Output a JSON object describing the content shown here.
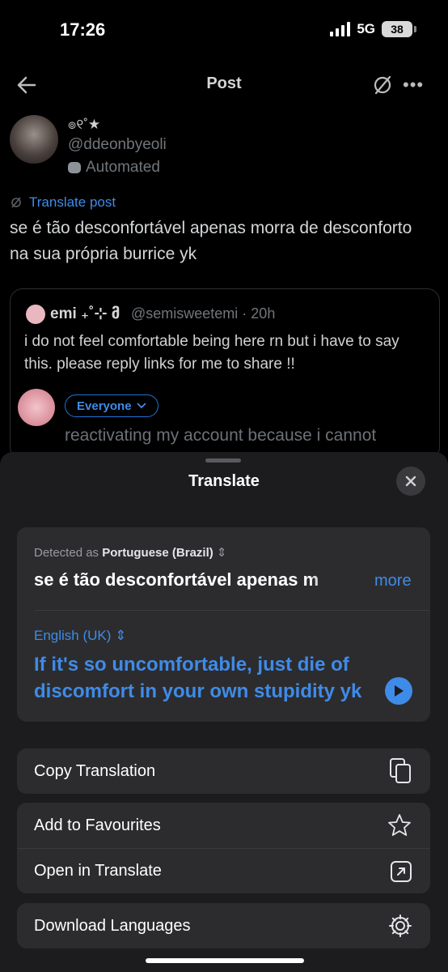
{
  "status": {
    "time": "17:26",
    "network": "5G",
    "battery": "38"
  },
  "nav": {
    "title": "Post"
  },
  "post": {
    "display_name": "๏୧˚★",
    "handle": "@ddeonbyeoli",
    "automated": "Automated",
    "translate_link": "Translate post",
    "text": "se é tão desconfortável apenas morra de desconforto na sua própria burrice yk"
  },
  "quoted": {
    "name": "emi ₊˚⊹ მ",
    "handle_time": "@semisweetemi · 20h",
    "text": "i do not feel comfortable being here rn but i have to say this. please reply links for me to share !!"
  },
  "reply": {
    "audience": "Everyone",
    "text": "reactivating my account because i cannot"
  },
  "sheet": {
    "title": "Translate",
    "detected_prefix": "Detected as",
    "source_language": "Portuguese (Brazil)",
    "source_text": "se é tão desconfortável apenas m",
    "more": "more",
    "target_language": "English (UK)",
    "translation": "If it's so uncomfortable, just die of discomfort in your own stupidity yk",
    "actions": {
      "copy": "Copy Translation",
      "favourites": "Add to Favourites",
      "open": "Open in Translate",
      "download": "Download Languages"
    }
  },
  "colors": {
    "accent": "#3f8be8",
    "sheet_bg": "#1c1c1e",
    "card_bg": "#2c2c2e"
  }
}
